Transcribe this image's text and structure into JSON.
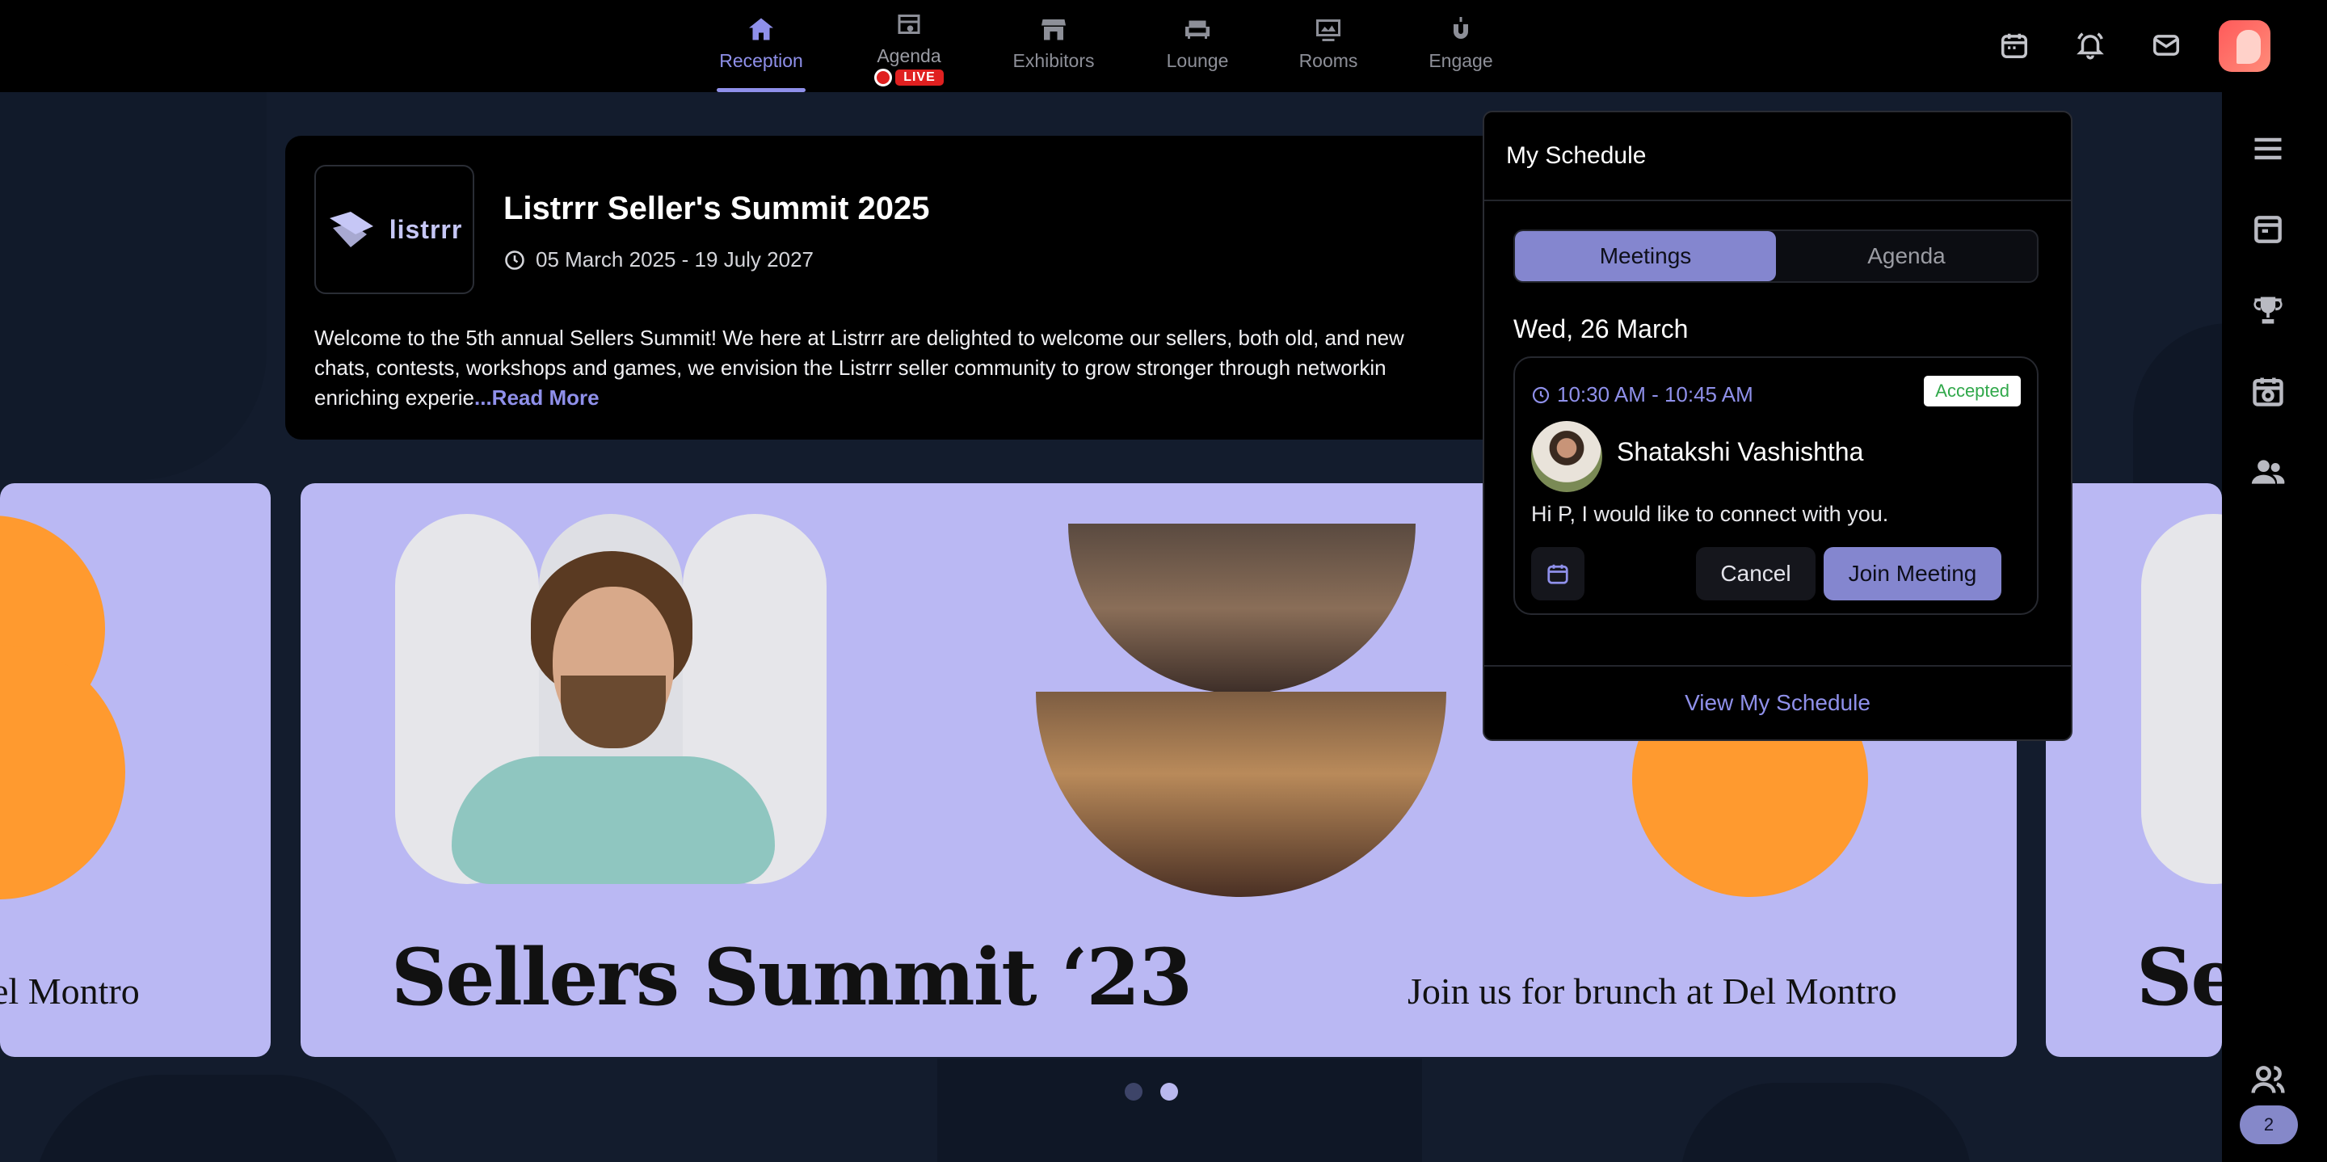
{
  "nav": {
    "items": [
      {
        "label": "Reception",
        "icon": "home-icon",
        "active": true
      },
      {
        "label": "Agenda",
        "icon": "agenda-icon",
        "active": false
      },
      {
        "label": "Exhibitors",
        "icon": "store-icon",
        "active": false
      },
      {
        "label": "Lounge",
        "icon": "sofa-icon",
        "active": false
      },
      {
        "label": "Rooms",
        "icon": "screen-icon",
        "active": false
      },
      {
        "label": "Engage",
        "icon": "magnet-icon",
        "active": false
      }
    ],
    "live_label": "LIVE"
  },
  "top_actions": {
    "icons": [
      "calendar-icon",
      "bell-icon",
      "mail-icon",
      "user-avatar"
    ]
  },
  "event": {
    "logo_text": "listrrr",
    "title": "Listrrr Seller's Summit 2025",
    "dates": "05 March 2025 - 19 July 2027",
    "description": "Welcome to the 5th annual Sellers Summit! We here at Listrrr are delighted to welcome our sellers, both old, and new\nchats, contests, workshops and games, we envision the Listrrr seller community to grow stronger through networkin\nenriching experie",
    "read_more": "...Read More"
  },
  "carousel": {
    "slide_title": "Sellers Summit ‘23",
    "slide_subtitle": "Join us for brunch at Del Montro",
    "left_partial_subtitle": "el Montro",
    "right_partial_title": "Se",
    "active_dot": 1,
    "dot_count": 2
  },
  "schedule": {
    "title": "My Schedule",
    "tabs": [
      "Meetings",
      "Agenda"
    ],
    "active_tab": "Meetings",
    "date": "Wed, 26 March",
    "meeting": {
      "time": "10:30 AM - 10:45 AM",
      "status": "Accepted",
      "person": "Shatakshi Vashishtha",
      "message": "Hi P, I would like to connect with you.",
      "cancel_label": "Cancel",
      "join_label": "Join Meeting"
    },
    "footer_link": "View My Schedule"
  },
  "sidebar": {
    "icons": [
      "menu-icon",
      "card-icon",
      "trophy-icon",
      "camera-calendar-icon",
      "people-icon",
      "users-icon"
    ],
    "count": "2"
  },
  "colors": {
    "accent": "#8f90ea",
    "slide_bg": "#bab8f3",
    "orange": "#ff9a2f",
    "live_red": "#e02020"
  }
}
